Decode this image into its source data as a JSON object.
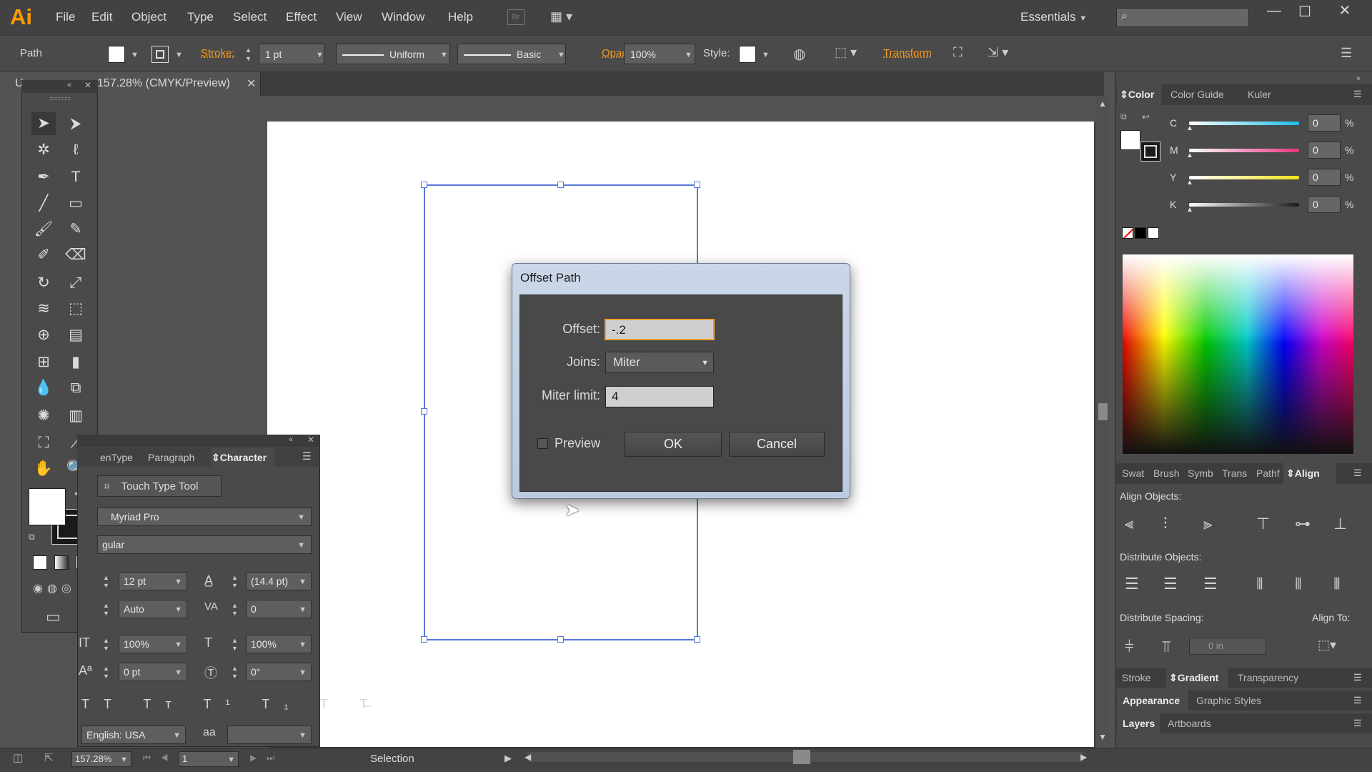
{
  "app": {
    "logo": "Ai"
  },
  "menu": [
    "File",
    "Edit",
    "Object",
    "Type",
    "Select",
    "Effect",
    "View",
    "Window",
    "Help"
  ],
  "menu_extras": {
    "bridge": "Br",
    "workspace": "Essentials"
  },
  "control_bar": {
    "selection_label": "Path",
    "stroke_label": "Stroke:",
    "stroke_weight": "1 pt",
    "profile": "Uniform",
    "brush": "Basic",
    "opacity_label": "Opacity:",
    "opacity_value": "100%",
    "style_label": "Style:",
    "transform_label": "Transform"
  },
  "document_tab": {
    "title": "157.28% (CMYK/Preview)",
    "prefix": "U"
  },
  "tools": [
    "selection-tool",
    "direct-selection-tool",
    "magic-wand-tool",
    "lasso-tool",
    "pen-tool",
    "type-tool",
    "line-tool",
    "rectangle-tool",
    "paintbrush-tool",
    "pencil-tool",
    "blob-brush-tool",
    "eraser-tool",
    "rotate-tool",
    "scale-tool",
    "warp-tool",
    "free-transform-tool",
    "shape-builder-tool",
    "perspective-grid-tool",
    "mesh-tool",
    "gradient-tool",
    "eyedropper-tool",
    "blend-tool",
    "symbol-sprayer-tool",
    "column-graph-tool",
    "artboard-tool",
    "slice-tool",
    "hand-tool",
    "zoom-tool"
  ],
  "character_panel": {
    "tabs": [
      "enType",
      "Paragraph",
      "Character"
    ],
    "active_tab": "Character",
    "touch_type": "Touch Type Tool",
    "font_family": "Myriad Pro",
    "font_style": "gular",
    "font_size": "12 pt",
    "leading": "(14.4 pt)",
    "kerning": "Auto",
    "tracking": "0",
    "vertical_scale": "100%",
    "horizontal_scale": "100%",
    "baseline_shift": "0 pt",
    "rotation": "0°",
    "language": "English: USA",
    "aa_glyph": "aa"
  },
  "color_panel": {
    "tabs": [
      "Color",
      "Color Guide",
      "Kuler"
    ],
    "active_tab": "Color",
    "channels": [
      {
        "label": "C",
        "value": "0",
        "unit": "%",
        "color": "#1bbde8"
      },
      {
        "label": "M",
        "value": "0",
        "unit": "%",
        "color": "#e8347f"
      },
      {
        "label": "Y",
        "value": "0",
        "unit": "%",
        "color": "#f2e21a"
      },
      {
        "label": "K",
        "value": "0",
        "unit": "%",
        "color": "#1a1a1a"
      }
    ]
  },
  "align_panel": {
    "tabs": [
      "Swat",
      "Brush",
      "Symb",
      "Trans",
      "Pathf",
      "Align"
    ],
    "active_tab": "Align",
    "align_objects": "Align Objects:",
    "distribute_objects": "Distribute Objects:",
    "distribute_spacing": "Distribute Spacing:",
    "spacing_value": "0 in",
    "align_to": "Align To:"
  },
  "bottom_panels": {
    "row1": [
      "Stroke",
      "Gradient",
      "Transparency"
    ],
    "row1_active": "Gradient",
    "row2": [
      "Appearance",
      "Graphic Styles"
    ],
    "row3": [
      "Layers",
      "Artboards"
    ]
  },
  "status_bar": {
    "zoom": "157.28%",
    "artboard": "1",
    "tool": "Selection"
  },
  "dialog": {
    "title": "Offset Path",
    "offset_label": "Offset:",
    "offset_value": "-.2",
    "joins_label": "Joins:",
    "joins_value": "Miter",
    "miter_label": "Miter limit:",
    "miter_value": "4",
    "preview_label": "Preview",
    "ok": "OK",
    "cancel": "Cancel"
  }
}
